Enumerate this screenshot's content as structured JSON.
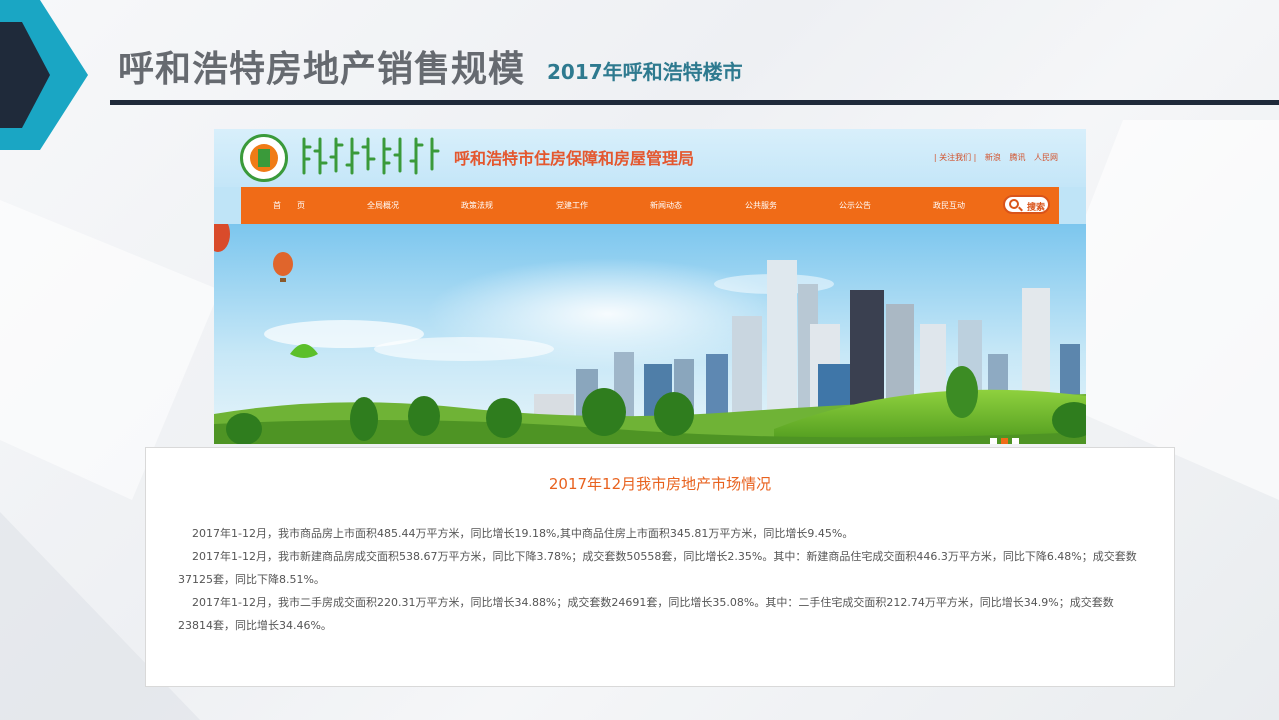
{
  "slide": {
    "title": "呼和浩特房地产销售规模",
    "subtitle": "2017年呼和浩特楼市"
  },
  "site": {
    "name": "呼和浩特市住房保障和房屋管理局",
    "top_links": [
      "| 关注我们 |",
      "新浪",
      "腾讯",
      "人民网"
    ],
    "nav": [
      "首　　页",
      "全局概况",
      "政策法规",
      "党建工作",
      "新闻动态",
      "公共服务",
      "公示公告",
      "政民互动"
    ],
    "search_label": "搜索"
  },
  "article": {
    "title": "2017年12月我市房地产市场情况",
    "paragraphs": [
      "2017年1-12月，我市商品房上市面积485.44万平方米，同比增长19.18%,其中商品住房上市面积345.81万平方米，同比增长9.45%。",
      "2017年1-12月，我市新建商品房成交面积538.67万平方米，同比下降3.78%；成交套数50558套，同比增长2.35%。其中：新建商品住宅成交面积446.3万平方米，同比下降6.48%；成交套数37125套，同比下降8.51%。",
      "2017年1-12月，我市二手房成交面积220.31万平方米，同比增长34.88%；成交套数24691套，同比增长35.08%。其中：二手住宅成交面积212.74万平方米，同比增长34.9%；成交套数23814套，同比增长34.46%。"
    ]
  },
  "colors": {
    "accent_teal": "#2e7a8f",
    "nav_orange": "#f06b17",
    "title_orange": "#e8621f",
    "rule_dark": "#1f2a3a"
  }
}
